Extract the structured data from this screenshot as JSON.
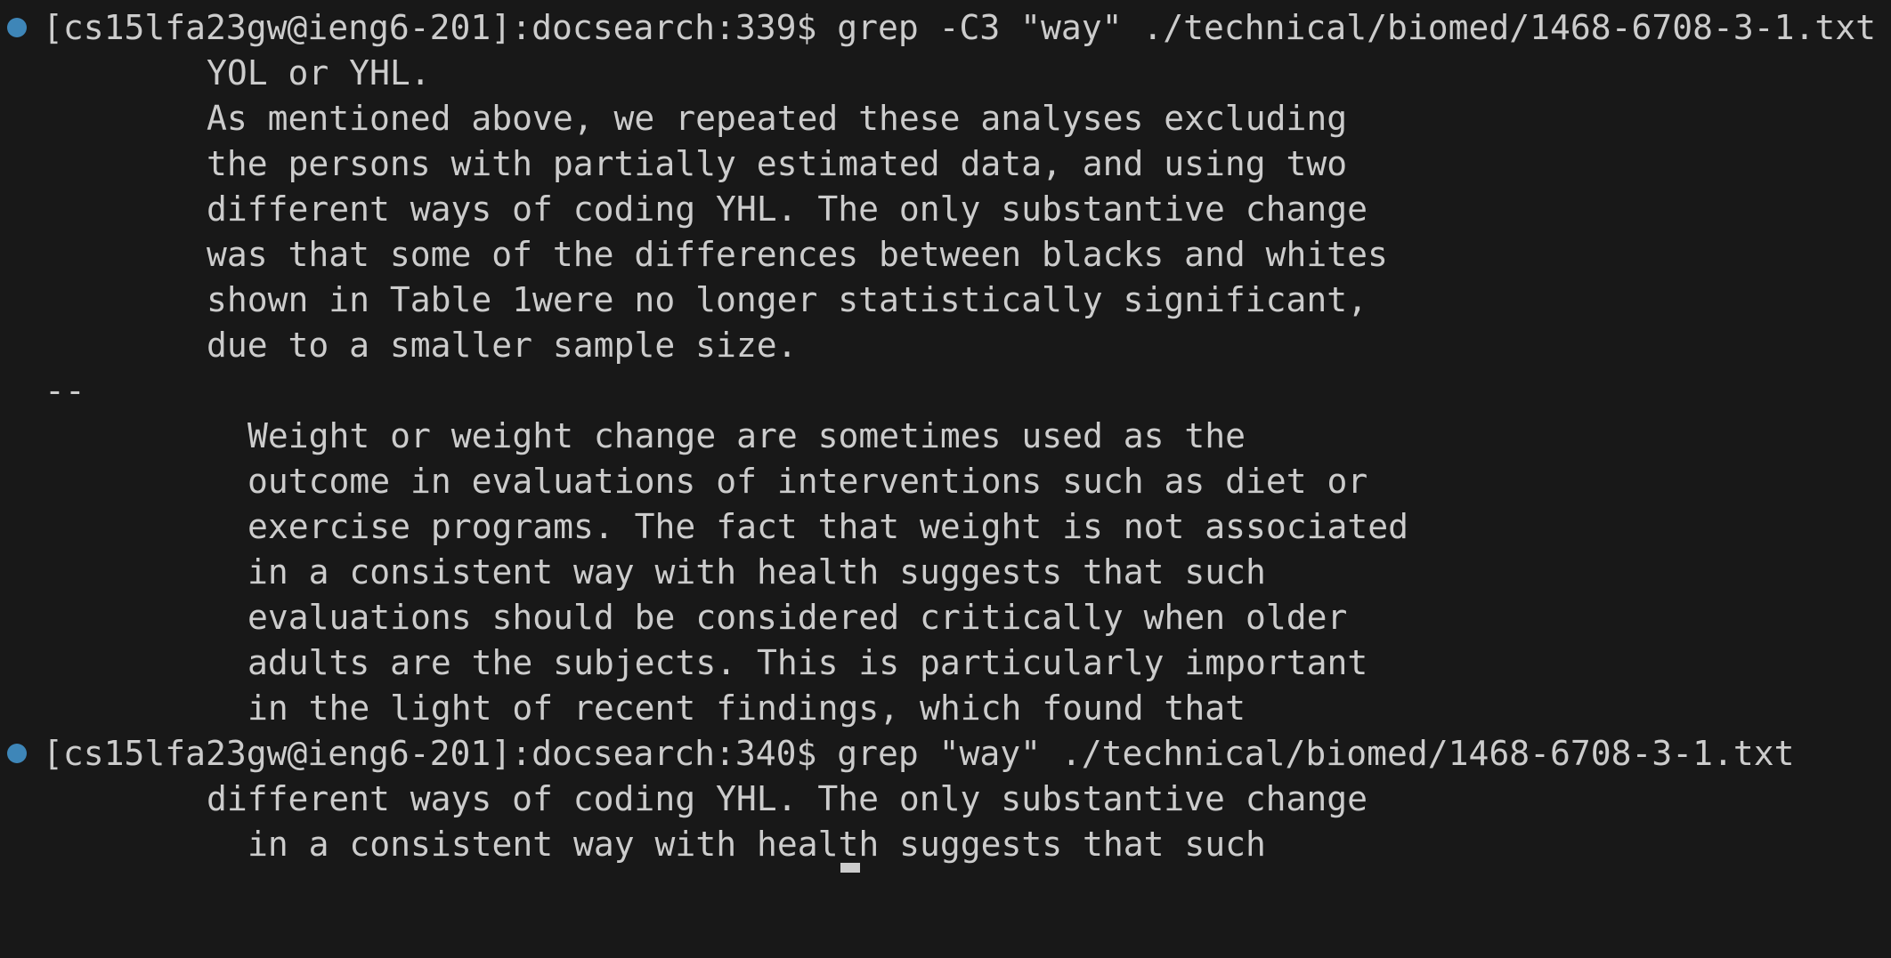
{
  "terminal": {
    "block1": {
      "prompt": "[cs15lfa23gw@ieng6-201]:docsearch:339$ grep -C3 \"way\" ./technical/biomed/1468-6708-3-1.txt",
      "lines": [
        "YOL or YHL.",
        "As mentioned above, we repeated these analyses excluding",
        "the persons with partially estimated data, and using two",
        "different ways of coding YHL. The only substantive change",
        "was that some of the differences between blacks and whites",
        "shown in Table 1were no longer statistically significant,",
        "due to a smaller sample size."
      ],
      "separator": "--",
      "lines2": [
        "Weight or weight change are sometimes used as the",
        "outcome in evaluations of interventions such as diet or",
        "exercise programs. The fact that weight is not associated",
        "in a consistent way with health suggests that such",
        "evaluations should be considered critically when older",
        "adults are the subjects. This is particularly important",
        "in the light of recent findings, which found that"
      ]
    },
    "block2": {
      "prompt": "[cs15lfa23gw@ieng6-201]:docsearch:340$ grep \"way\" ./technical/biomed/1468-6708-3-1.txt",
      "lines": [
        "different ways of coding YHL. The only substantive change"
      ],
      "lines2": [
        "in a consistent way with health suggests that such"
      ]
    }
  }
}
